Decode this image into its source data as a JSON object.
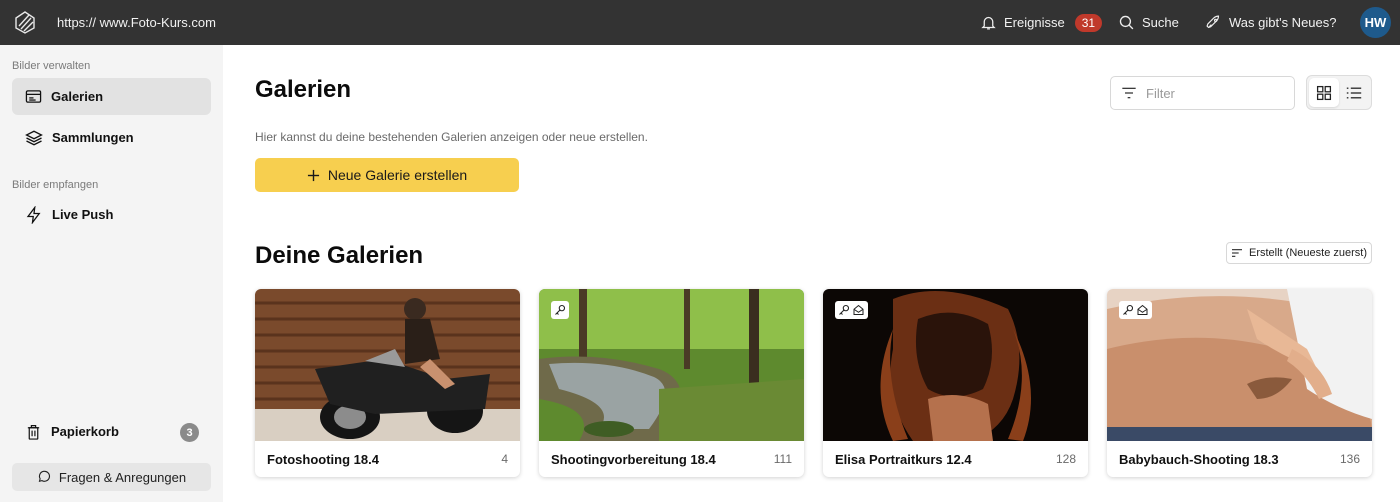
{
  "topbar": {
    "url": "https:// www.Foto-Kurs.com",
    "events_label": "Ereignisse",
    "events_count": "31",
    "search_label": "Suche",
    "whats_new_label": "Was gibt's Neues?",
    "avatar_initials": "HW"
  },
  "sidebar": {
    "section_manage": "Bilder verwalten",
    "galleries": "Galerien",
    "collections": "Sammlungen",
    "section_receive": "Bilder empfangen",
    "live_push": "Live Push",
    "trash": "Papierkorb",
    "trash_count": "3",
    "feedback": "Fragen & Anregungen"
  },
  "main": {
    "title": "Galerien",
    "subtitle": "Hier kannst du deine bestehenden Galerien anzeigen oder neue erstellen.",
    "create_button": "Neue Galerie erstellen",
    "filter_placeholder": "Filter",
    "section_title": "Deine Galerien",
    "sort_label": "Erstellt (Neueste zuerst)"
  },
  "galleries": [
    {
      "title": "Fotoshooting 18.4",
      "count": "4"
    },
    {
      "title": "Shootingvorbereitung 18.4",
      "count": "111"
    },
    {
      "title": "Elisa Portraitkurs 12.4",
      "count": "128"
    },
    {
      "title": "Babybauch-Shooting 18.3",
      "count": "136"
    }
  ],
  "colors": {
    "topbar": "#333333",
    "accent_yellow": "#f7cf4f",
    "badge_red": "#c0392b",
    "avatar_blue": "#1e5a8c"
  }
}
